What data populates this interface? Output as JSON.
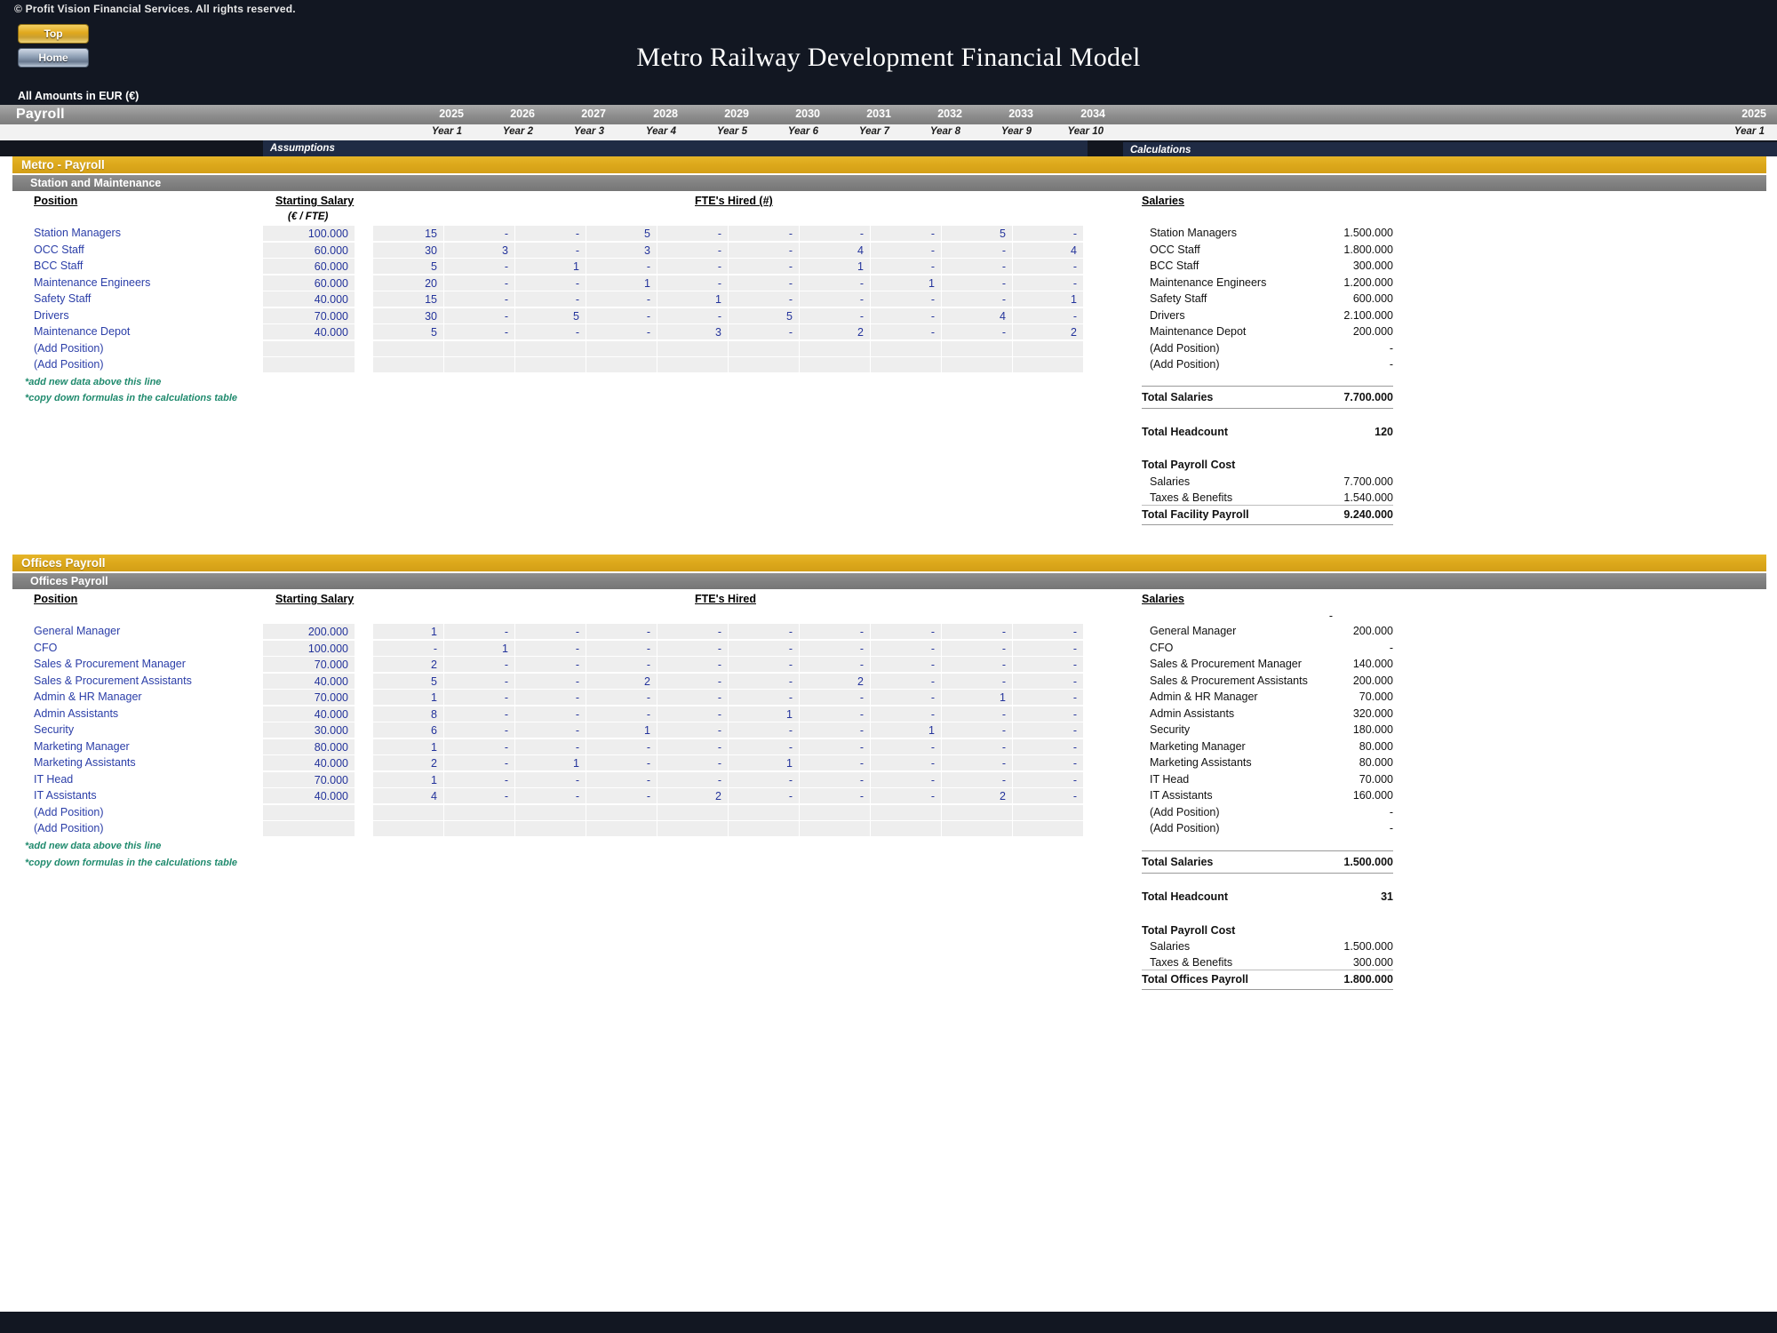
{
  "window": {
    "copyright": "© Profit Vision Financial Services. All rights reserved.",
    "title": "Metro Railway Development Financial Model",
    "currency_note": "All Amounts in  EUR (€)",
    "sheet_name": "Payroll"
  },
  "nav": {
    "top_label": "Top",
    "home_label": "Home"
  },
  "panels": {
    "assumptions_label": "Assumptions",
    "calculations_label": "Calculations"
  },
  "timeline": {
    "years": [
      "2025",
      "2026",
      "2027",
      "2028",
      "2029",
      "2030",
      "2031",
      "2032",
      "2033",
      "2034"
    ],
    "year_labels": [
      "Year 1",
      "Year 2",
      "Year 3",
      "Year 4",
      "Year 5",
      "Year 6",
      "Year 7",
      "Year 8",
      "Year 9",
      "Year 10"
    ],
    "calc_year": "2025",
    "calc_year_label": "Year 1"
  },
  "headers": {
    "position": "Position",
    "starting_salary": "Starting Salary",
    "starting_salary_unit": "(€ / FTE)",
    "fte_hired_metro": "FTE's Hired (#)",
    "fte_hired_offices": "FTE's Hired",
    "salaries": "Salaries"
  },
  "notes": {
    "add_line": "*add new data above this line",
    "copy_line": "*copy down formulas in the calculations table"
  },
  "metro": {
    "section_title": "Metro - Payroll",
    "subsection_title": "Station and Maintenance",
    "rows": [
      {
        "position": "Station Managers",
        "salary": "100.000",
        "fte": [
          "15",
          "-",
          "-",
          "5",
          "-",
          "-",
          "-",
          "-",
          "5",
          "-"
        ],
        "calc_salary": "1.500.000"
      },
      {
        "position": "OCC Staff",
        "salary": "60.000",
        "fte": [
          "30",
          "3",
          "-",
          "3",
          "-",
          "-",
          "4",
          "-",
          "-",
          "4"
        ],
        "calc_salary": "1.800.000"
      },
      {
        "position": "BCC Staff",
        "salary": "60.000",
        "fte": [
          "5",
          "-",
          "1",
          "-",
          "-",
          "-",
          "1",
          "-",
          "-",
          "-"
        ],
        "calc_salary": "300.000"
      },
      {
        "position": "Maintenance Engineers",
        "salary": "60.000",
        "fte": [
          "20",
          "-",
          "-",
          "1",
          "-",
          "-",
          "-",
          "1",
          "-",
          "-"
        ],
        "calc_salary": "1.200.000"
      },
      {
        "position": "Safety Staff",
        "salary": "40.000",
        "fte": [
          "15",
          "-",
          "-",
          "-",
          "1",
          "-",
          "-",
          "-",
          "-",
          "1"
        ],
        "calc_salary": "600.000"
      },
      {
        "position": "Drivers",
        "salary": "70.000",
        "fte": [
          "30",
          "-",
          "5",
          "-",
          "-",
          "5",
          "-",
          "-",
          "4",
          "-"
        ],
        "calc_salary": "2.100.000"
      },
      {
        "position": "Maintenance Depot",
        "salary": "40.000",
        "fte": [
          "5",
          "-",
          "-",
          "-",
          "3",
          "-",
          "2",
          "-",
          "-",
          "2"
        ],
        "calc_salary": "200.000"
      },
      {
        "position": "(Add Position)",
        "salary": "",
        "fte": [
          "",
          "",
          "",
          "",
          "",
          "",
          "",
          "",
          "",
          ""
        ],
        "calc_salary": "-"
      },
      {
        "position": "(Add Position)",
        "salary": "",
        "fte": [
          "",
          "",
          "",
          "",
          "",
          "",
          "",
          "",
          "",
          ""
        ],
        "calc_salary": "-"
      }
    ],
    "total_salaries_label": "Total Salaries",
    "total_salaries_value": "7.700.000",
    "total_headcount_label": "Total Headcount",
    "total_headcount_value": "120",
    "total_payroll_cost_label": "Total Payroll Cost",
    "cost_salaries_label": "Salaries",
    "cost_salaries_value": "7.700.000",
    "cost_taxes_label": "Taxes & Benefits",
    "cost_taxes_value": "1.540.000",
    "total_facility_label": "Total Facility Payroll",
    "total_facility_value": "9.240.000"
  },
  "offices": {
    "section_title": "Offices Payroll",
    "subsection_title": "Offices Payroll",
    "rows": [
      {
        "position": "General Manager",
        "salary": "200.000",
        "fte": [
          "1",
          "-",
          "-",
          "-",
          "-",
          "-",
          "-",
          "-",
          "-",
          "-"
        ],
        "calc_salary": "200.000"
      },
      {
        "position": "CFO",
        "salary": "100.000",
        "fte": [
          "-",
          "1",
          "-",
          "-",
          "-",
          "-",
          "-",
          "-",
          "-",
          "-"
        ],
        "calc_salary": "-"
      },
      {
        "position": "Sales & Procurement Manager",
        "salary": "70.000",
        "fte": [
          "2",
          "-",
          "-",
          "-",
          "-",
          "-",
          "-",
          "-",
          "-",
          "-"
        ],
        "calc_salary": "140.000"
      },
      {
        "position": "Sales & Procurement Assistants",
        "salary": "40.000",
        "fte": [
          "5",
          "-",
          "-",
          "2",
          "-",
          "-",
          "2",
          "-",
          "-",
          "-"
        ],
        "calc_salary": "200.000"
      },
      {
        "position": "Admin & HR Manager",
        "salary": "70.000",
        "fte": [
          "1",
          "-",
          "-",
          "-",
          "-",
          "-",
          "-",
          "-",
          "1",
          "-"
        ],
        "calc_salary": "70.000"
      },
      {
        "position": "Admin Assistants",
        "salary": "40.000",
        "fte": [
          "8",
          "-",
          "-",
          "-",
          "-",
          "1",
          "-",
          "-",
          "-",
          "-"
        ],
        "calc_salary": "320.000"
      },
      {
        "position": "Security",
        "salary": "30.000",
        "fte": [
          "6",
          "-",
          "-",
          "1",
          "-",
          "-",
          "-",
          "1",
          "-",
          "-"
        ],
        "calc_salary": "180.000"
      },
      {
        "position": "Marketing Manager",
        "salary": "80.000",
        "fte": [
          "1",
          "-",
          "-",
          "-",
          "-",
          "-",
          "-",
          "-",
          "-",
          "-"
        ],
        "calc_salary": "80.000"
      },
      {
        "position": "Marketing Assistants",
        "salary": "40.000",
        "fte": [
          "2",
          "-",
          "1",
          "-",
          "-",
          "1",
          "-",
          "-",
          "-",
          "-"
        ],
        "calc_salary": "80.000"
      },
      {
        "position": "IT Head",
        "salary": "70.000",
        "fte": [
          "1",
          "-",
          "-",
          "-",
          "-",
          "-",
          "-",
          "-",
          "-",
          "-"
        ],
        "calc_salary": "70.000"
      },
      {
        "position": "IT Assistants",
        "salary": "40.000",
        "fte": [
          "4",
          "-",
          "-",
          "-",
          "2",
          "-",
          "-",
          "-",
          "2",
          "-"
        ],
        "calc_salary": "160.000"
      },
      {
        "position": "(Add Position)",
        "salary": "",
        "fte": [
          "",
          "",
          "",
          "",
          "",
          "",
          "",
          "",
          "",
          ""
        ],
        "calc_salary": "-"
      },
      {
        "position": "(Add Position)",
        "salary": "",
        "fte": [
          "",
          "",
          "",
          "",
          "",
          "",
          "",
          "",
          "",
          ""
        ],
        "calc_salary": "-"
      }
    ],
    "blank_top_value": "-",
    "total_salaries_label": "Total Salaries",
    "total_salaries_value": "1.500.000",
    "total_headcount_label": "Total Headcount",
    "total_headcount_value": "31",
    "total_payroll_cost_label": "Total Payroll Cost",
    "cost_salaries_label": "Salaries",
    "cost_salaries_value": "1.500.000",
    "cost_taxes_label": "Taxes & Benefits",
    "cost_taxes_value": "300.000",
    "total_offices_label": "Total Offices Payroll",
    "total_offices_value": "1.800.000"
  },
  "colors": {
    "gold": "#dca81b",
    "grey_bar": "#808080",
    "dark_navy": "#1f2b44",
    "input_blue": "#23339b"
  }
}
